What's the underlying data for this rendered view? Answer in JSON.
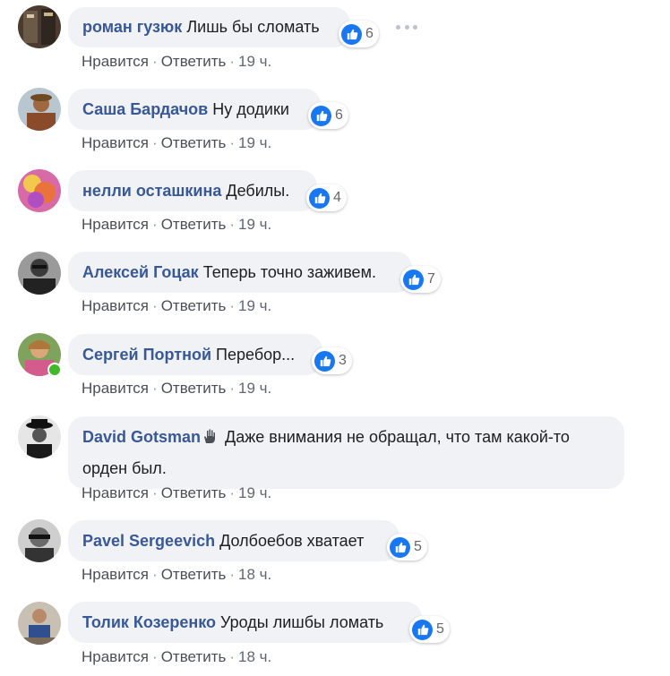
{
  "comments": [
    {
      "author": "роман гузюк",
      "text": "Лишь бы сломать",
      "reactions": "6",
      "like": "Нравится",
      "reply": "Ответить",
      "time": "19 ч."
    },
    {
      "author": "Саша Бардачов",
      "text": "Ну додики",
      "reactions": "6",
      "like": "Нравится",
      "reply": "Ответить",
      "time": "19 ч."
    },
    {
      "author": "нелли осташкина",
      "text": "Дебилы.",
      "reactions": "4",
      "like": "Нравится",
      "reply": "Ответить",
      "time": "19 ч."
    },
    {
      "author": "Алексей Гоцак",
      "text": "Теперь точно заживем.",
      "reactions": "7",
      "like": "Нравится",
      "reply": "Ответить",
      "time": "19 ч."
    },
    {
      "author": "Сергей Портной",
      "text": "Перебор...",
      "reactions": "3",
      "like": "Нравится",
      "reply": "Ответить",
      "time": "19 ч."
    },
    {
      "author": "David Gotsman",
      "text": "Даже внимания не обращал, что там какой-то орден был.",
      "like": "Нравится",
      "reply": "Ответить",
      "time": "19 ч.",
      "author_icon": "hand-icon"
    },
    {
      "author": "Pavel Sergeevich",
      "text": "Долбоебов хватает",
      "reactions": "5",
      "like": "Нравится",
      "reply": "Ответить",
      "time": "18 ч."
    },
    {
      "author": "Толик Козеренко",
      "text": "Уроды лишбы ломать",
      "reactions": "5",
      "like": "Нравится",
      "reply": "Ответить",
      "time": "18 ч."
    }
  ],
  "separator": "·",
  "colors": {
    "author": "#385898",
    "bubble": "#f0f2f5",
    "like_blue": "#1877f2",
    "online": "#42b72a"
  }
}
